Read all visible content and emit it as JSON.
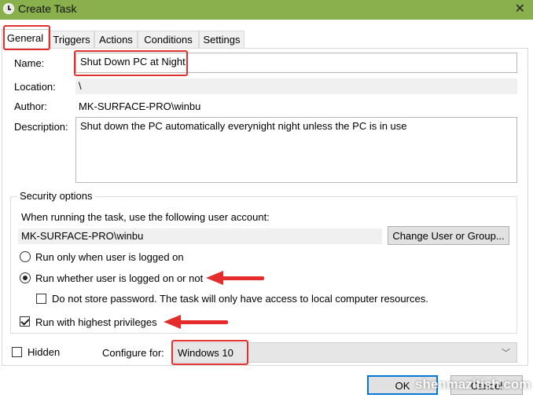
{
  "window": {
    "title": "Create Task",
    "close_glyph": "✕",
    "title_icon": "task-scheduler-clock-icon"
  },
  "tabs": [
    {
      "label": "General",
      "active": true
    },
    {
      "label": "Triggers",
      "active": false
    },
    {
      "label": "Actions",
      "active": false
    },
    {
      "label": "Conditions",
      "active": false
    },
    {
      "label": "Settings",
      "active": false
    }
  ],
  "general": {
    "name_label": "Name:",
    "name_value": "Shut Down PC at Night",
    "location_label": "Location:",
    "location_value": "\\",
    "author_label": "Author:",
    "author_value": "MK-SURFACE-PRO\\winbu",
    "description_label": "Description:",
    "description_value": "Shut down the PC automatically everynight night unless the PC is in use"
  },
  "security": {
    "group_title": "Security options",
    "account_prompt": "When running the task, use the following user account:",
    "account_value": "MK-SURFACE-PRO\\winbu",
    "change_button": "Change User or Group...",
    "radio_logged_on": {
      "label": "Run only when user is logged on",
      "selected": false
    },
    "radio_whether": {
      "label": "Run whether user is logged on or not",
      "selected": true
    },
    "no_store_password": {
      "label": "Do not store password.  The task will only have access to local computer resources.",
      "checked": false
    },
    "highest_privileges": {
      "label": "Run with highest privileges",
      "checked": true
    }
  },
  "footer": {
    "hidden_label": "Hidden",
    "hidden_checked": false,
    "configure_label": "Configure for:",
    "configure_value": "Windows 10",
    "ok_button": "OK",
    "cancel_button": "Cancel"
  },
  "annotations": {
    "highlight_color": "#e03030",
    "arrow_color": "#e52b2b"
  },
  "watermark": "shenmazitish.com",
  "colors": {
    "titlebar": "#8ab04e",
    "readonly_field": "#f0f0f0",
    "dropdown": "#e6e6e6",
    "primary_button_border": "#0078d7"
  }
}
